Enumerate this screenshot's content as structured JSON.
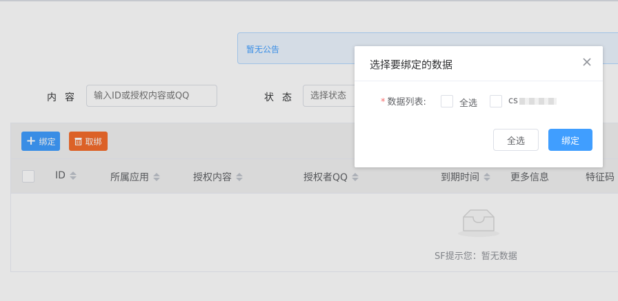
{
  "notice": {
    "text": "暂无公告"
  },
  "filters": {
    "content_label": "内容",
    "content_placeholder": "输入ID或授权内容或QQ",
    "status_label": "状态",
    "status_placeholder": "选择状态"
  },
  "toolbar": {
    "bind_label": "绑定",
    "unbind_label": "取绑"
  },
  "table": {
    "columns": [
      "ID",
      "所属应用",
      "授权内容",
      "授权者QQ",
      "到期时间",
      "更多信息",
      "特征码"
    ],
    "empty_text": "SF提示您：暂无数据"
  },
  "dialog": {
    "title": "选择要绑定的数据",
    "field_label": "数据列表:",
    "required_mark": "*",
    "options": [
      "全选",
      "cs"
    ],
    "select_all_button": "全选",
    "confirm_button": "绑定"
  },
  "colors": {
    "primary": "#409eff",
    "danger": "#f56c2c",
    "required": "#f56c6c"
  }
}
